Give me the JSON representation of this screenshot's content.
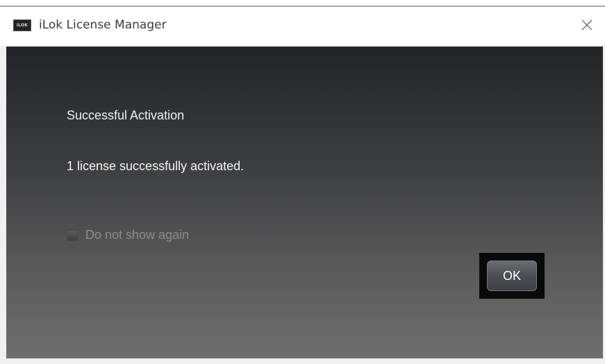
{
  "window": {
    "title": "iLok License Manager",
    "app_icon_text": "iLOK",
    "app_icon": "ilok-logo-icon",
    "close_icon": "close-icon"
  },
  "dialog": {
    "heading": "Successful Activation",
    "message": "1 license successfully activated.",
    "checkbox_label": "Do not show again",
    "checkbox_checked": false,
    "ok_label": "OK"
  },
  "colors": {
    "titlebar_bg": "#ffffff",
    "content_top": "#232427",
    "content_bottom": "#6f6f6f",
    "text_primary": "#f0f0f0",
    "text_disabled": "#8c8c8c"
  }
}
